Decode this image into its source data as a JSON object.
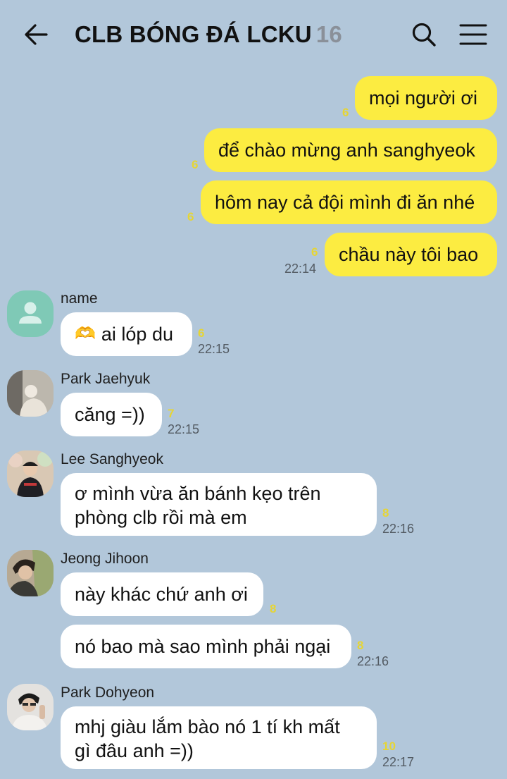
{
  "header": {
    "title": "CLB BÓNG ĐÁ LCKU",
    "member_count": "16"
  },
  "colors": {
    "background": "#b2c7da",
    "my_bubble": "#fcec41",
    "their_bubble": "#ffffff",
    "unread": "#e6d534"
  },
  "messages": {
    "m1": {
      "text": "mọi người ơi",
      "unread": "6"
    },
    "m2": {
      "text": "để chào mừng anh sanghyeok",
      "unread": "6"
    },
    "m3": {
      "text": "hôm nay cả đội mình đi ăn nhé",
      "unread": "6"
    },
    "m4": {
      "text": "chầu này tôi bao",
      "unread": "6",
      "time": "22:14"
    },
    "m5": {
      "sender": "name",
      "emoji": "🫶",
      "text": "ai lóp du",
      "unread": "6",
      "time": "22:15"
    },
    "m6": {
      "sender": "Park Jaehyuk",
      "text": "căng =))",
      "unread": "7",
      "time": "22:15"
    },
    "m7": {
      "sender": "Lee Sanghyeok",
      "line1": "ơ mình vừa ăn bánh kẹo trên",
      "line2": "phòng clb rồi mà em",
      "unread": "8",
      "time": "22:16"
    },
    "m8": {
      "sender": "Jeong Jihoon",
      "text": "này khác chứ anh ơi",
      "unread": "8"
    },
    "m9": {
      "text": "nó bao mà sao mình phải ngại",
      "unread": "8",
      "time": "22:16"
    },
    "m10": {
      "sender": "Park Dohyeon",
      "line1": "mhj giàu lắm bào nó 1 tí kh mất",
      "line2": "gì đâu anh =))",
      "unread": "10",
      "time": "22:17"
    }
  },
  "icons": {
    "back": "arrow-left-icon",
    "search": "search-icon",
    "menu": "hamburger-menu-icon",
    "default_avatar": "person-icon"
  }
}
